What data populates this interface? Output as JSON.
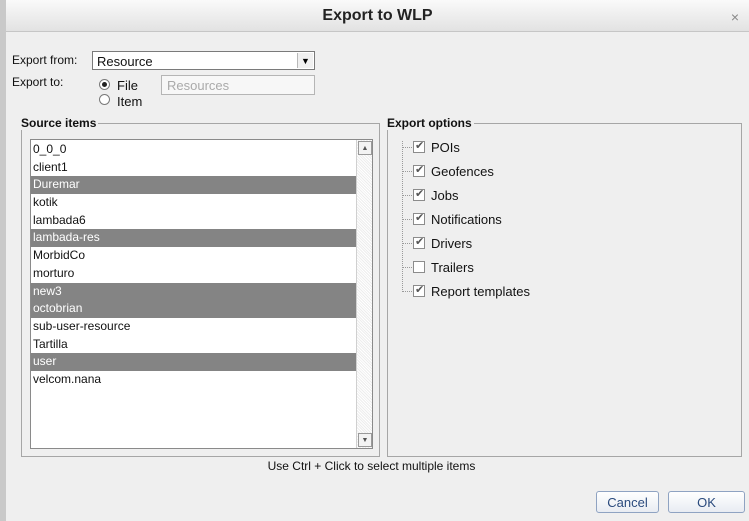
{
  "dialog": {
    "title": "Export to WLP",
    "close_glyph": "×"
  },
  "form": {
    "export_from_label": "Export from:",
    "export_from_value": "Resource",
    "export_to_label": "Export to:",
    "radio_file_label": "File",
    "radio_item_label": "Item",
    "selected_target": "File",
    "file_placeholder": "Resources"
  },
  "source": {
    "legend": "Source items",
    "items": [
      {
        "label": "0_0_0",
        "selected": false
      },
      {
        "label": "client1",
        "selected": false
      },
      {
        "label": "Duremar",
        "selected": true
      },
      {
        "label": "kotik",
        "selected": false
      },
      {
        "label": "lambada6",
        "selected": false
      },
      {
        "label": "lambada-res",
        "selected": true
      },
      {
        "label": "MorbidCo",
        "selected": false
      },
      {
        "label": "morturo",
        "selected": false
      },
      {
        "label": "new3",
        "selected": true
      },
      {
        "label": "octobrian",
        "selected": true
      },
      {
        "label": "sub-user-resource",
        "selected": false
      },
      {
        "label": "Tartilla",
        "selected": false
      },
      {
        "label": "user",
        "selected": true
      },
      {
        "label": "velcom.nana",
        "selected": false
      }
    ]
  },
  "options": {
    "legend": "Export options",
    "items": [
      {
        "label": "POIs",
        "checked": true
      },
      {
        "label": "Geofences",
        "checked": true
      },
      {
        "label": "Jobs",
        "checked": true
      },
      {
        "label": "Notifications",
        "checked": true
      },
      {
        "label": "Drivers",
        "checked": true
      },
      {
        "label": "Trailers",
        "checked": false
      },
      {
        "label": "Report templates",
        "checked": true
      }
    ]
  },
  "hint": "Use Ctrl + Click to select multiple items",
  "buttons": {
    "cancel": "Cancel",
    "ok": "OK"
  },
  "colors": {
    "selection": "#848484",
    "button_text": "#2a4a7d"
  }
}
